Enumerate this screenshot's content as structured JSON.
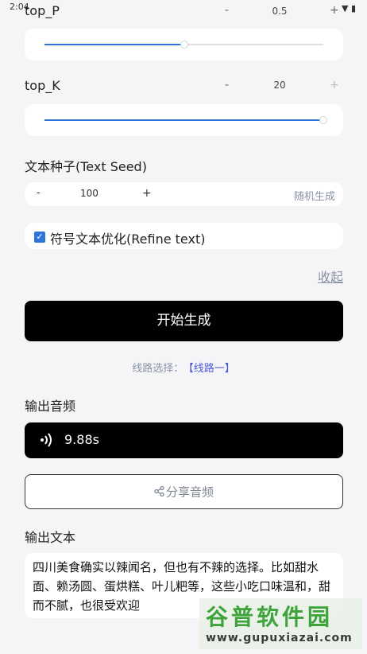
{
  "status": {
    "time": "2:04"
  },
  "top_p": {
    "label": "top_P",
    "minus": "-",
    "value": "0.5",
    "plus": "+",
    "slider_level": 0.5
  },
  "top_k": {
    "label": "top_K",
    "minus": "-",
    "value": "20",
    "plus": "+",
    "slider_level": 1.0
  },
  "seed": {
    "label": "文本种子(Text Seed)",
    "minus": "-",
    "value": "100",
    "plus": "+",
    "random_label": "随机生成"
  },
  "refine": {
    "checked": true,
    "label": "符号文本优化(Refine text)"
  },
  "collapse_label": "收起",
  "generate_label": "开始生成",
  "route": {
    "label": "线路选择：",
    "option": "【线路一】"
  },
  "output_audio": {
    "title": "输出音频",
    "duration": "9.88s"
  },
  "share_label": "分享音频",
  "output_text": {
    "title": "输出文本",
    "content": "四川美食确实以辣闻名，但也有不辣的选择。比如甜水面、赖汤圆、蛋烘糕、叶儿粑等，这些小吃口味温和，甜而不腻，也很受欢迎"
  },
  "watermark": {
    "title": "谷普软件园",
    "url": "www.gupuxiazai.com"
  },
  "colors": {
    "accent": "#2f74d8",
    "button_bg": "#000000",
    "link": "#4a5bd8"
  }
}
